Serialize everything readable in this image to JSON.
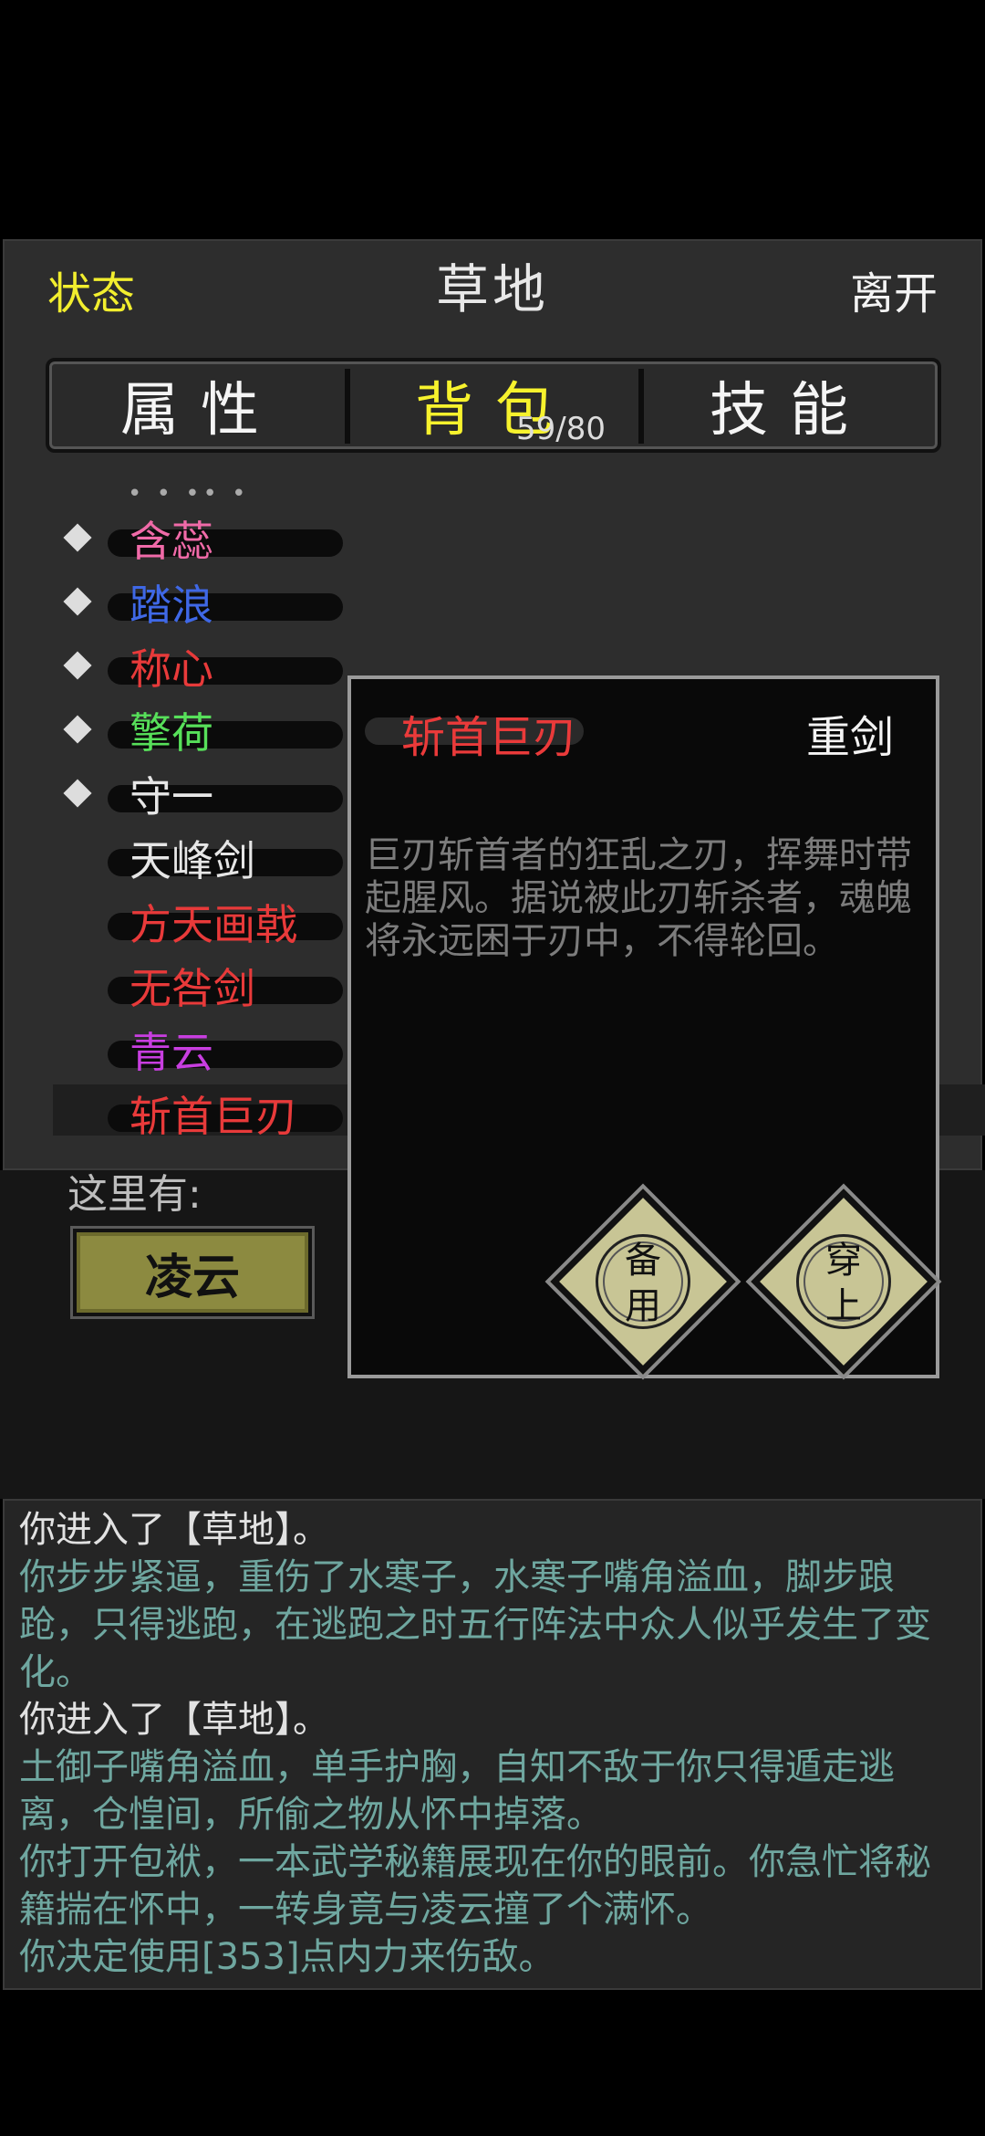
{
  "header": {
    "status_label": "状态",
    "location": "草地",
    "leave_label": "离开"
  },
  "tabs": [
    {
      "label": "属性",
      "active": false
    },
    {
      "label": "背包",
      "active": true
    },
    {
      "label": "技能",
      "active": false
    }
  ],
  "bag_count": "59/80",
  "inventory": {
    "truncated_marker": "• • •• •",
    "items": [
      {
        "name": "含蕊",
        "color": "#f06aa8",
        "marked": true
      },
      {
        "name": "踏浪",
        "color": "#3f68e6",
        "marked": true
      },
      {
        "name": "称心",
        "color": "#e83a3a",
        "marked": true
      },
      {
        "name": "擎荷",
        "color": "#57e05a",
        "marked": true
      },
      {
        "name": "守一",
        "color": "#e6e6e6",
        "marked": true
      },
      {
        "name": "天峰剑",
        "color": "#e6e6e6",
        "marked": false
      },
      {
        "name": "方天画戟",
        "color": "#e83a3a",
        "marked": false
      },
      {
        "name": "无咎剑",
        "color": "#e83a3a",
        "marked": false
      },
      {
        "name": "青云",
        "color": "#c83ee0",
        "marked": false
      },
      {
        "name": "斩首巨刃",
        "color": "#e83a3a",
        "marked": false,
        "selected": true
      }
    ]
  },
  "here": {
    "label": "这里有:",
    "npc": "凌云"
  },
  "detail": {
    "name": "斩首巨刃",
    "type": "重剑",
    "description": "巨刃斩首者的狂乱之刃，挥舞时带起腥风。据说被此刃斩杀者，魂魄将永远困于刃中，不得轮回。",
    "spare_label_1": "备",
    "spare_label_2": "用",
    "wear_label_1": "穿",
    "wear_label_2": "上"
  },
  "log": [
    {
      "text": "你进入了【草地】。",
      "style": "white"
    },
    {
      "text": "你步步紧逼，重伤了水寒子，水寒子嘴角溢血，脚步踉跄，只得逃跑，在逃跑之时五行阵法中众人似乎发生了变化。",
      "style": "teal"
    },
    {
      "text": "你进入了【草地】。",
      "style": "white"
    },
    {
      "text": "土御子嘴角溢血，单手护胸，自知不敌于你只得遁走逃离，仓惶间，所偷之物从怀中掉落。",
      "style": "teal"
    },
    {
      "text": "你打开包袱，一本武学秘籍展现在你的眼前。你急忙将秘籍揣在怀中，一转身竟与凌云撞了个满怀。",
      "style": "teal"
    },
    {
      "text": "你决定使用[353]点内力来伤敌。",
      "style": "teal"
    }
  ]
}
